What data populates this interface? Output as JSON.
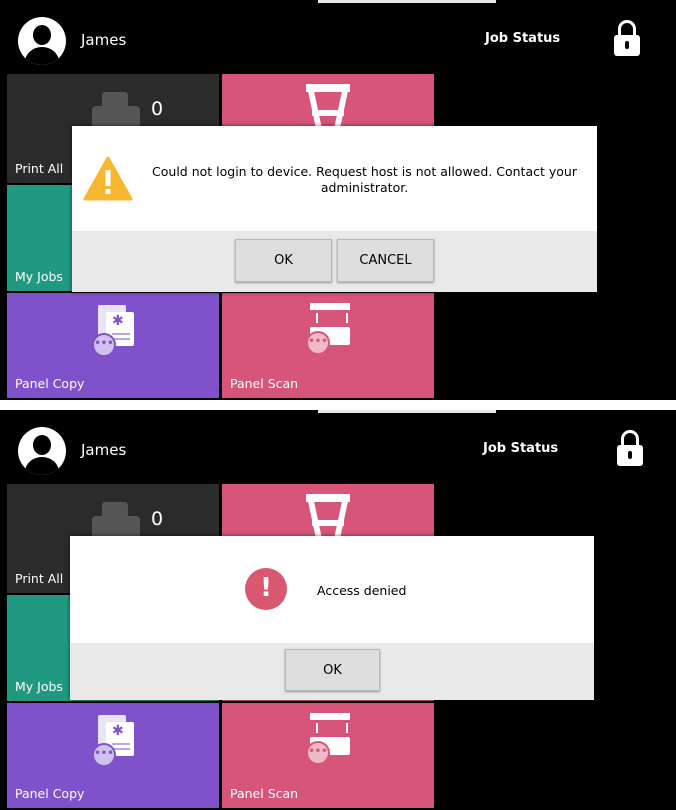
{
  "screen1": {
    "header": {
      "user_name": "James",
      "job_status": "Job Status"
    },
    "tiles": {
      "print_all": "Print All",
      "print_count": "0",
      "my_jobs": "My Jobs",
      "panel_copy": "Panel Copy",
      "panel_scan": "Panel Scan"
    },
    "dialog": {
      "icon": "warning-icon",
      "message": "Could not login to device. Request host is not allowed. Contact your administrator.",
      "ok_label": "OK",
      "cancel_label": "CANCEL"
    }
  },
  "screen2": {
    "header": {
      "user_name": "James",
      "job_status": "Job Status"
    },
    "tiles": {
      "print_all": "Print All",
      "print_count": "0",
      "my_jobs": "My Jobs",
      "panel_copy": "Panel Copy",
      "panel_scan": "Panel Scan"
    },
    "dialog": {
      "icon": "error-icon",
      "message": "Access denied",
      "ok_label": "OK"
    }
  },
  "colors": {
    "print_tile": "#2b2b2b",
    "my_jobs_tile": "#1f9a80",
    "panel_copy_tile": "#7f52cc",
    "panel_scan_tile": "#d65578",
    "warning": "#f7b731",
    "error": "#d9576f"
  }
}
